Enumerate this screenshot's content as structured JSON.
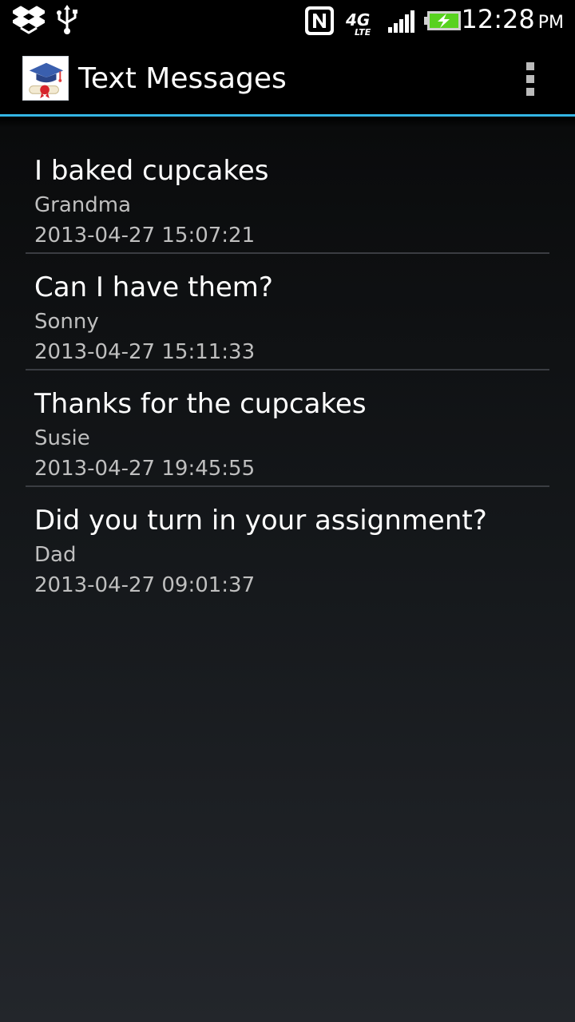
{
  "status_bar": {
    "time": "12:28",
    "ampm": "PM",
    "network_type": "4G",
    "network_sub": "LTE",
    "icons": [
      "dropbox-icon",
      "usb-icon",
      "nfc-icon",
      "network-4g-lte-icon",
      "signal-icon",
      "battery-charging-icon"
    ],
    "accent_battery": "#58d21f"
  },
  "action_bar": {
    "title": "Text Messages",
    "app_icon": "graduation-cap-diploma-icon",
    "overflow_icon": "overflow-menu-icon",
    "accent_color": "#33b5e5"
  },
  "messages": [
    {
      "text": "I baked cupcakes",
      "sender": "Grandma",
      "timestamp": "2013-04-27 15:07:21"
    },
    {
      "text": "Can I have them?",
      "sender": "Sonny",
      "timestamp": "2013-04-27 15:11:33"
    },
    {
      "text": "Thanks for the cupcakes",
      "sender": "Susie",
      "timestamp": "2013-04-27 19:45:55"
    },
    {
      "text": "Did you turn in your assignment?",
      "sender": "Dad",
      "timestamp": "2013-04-27 09:01:37"
    }
  ]
}
